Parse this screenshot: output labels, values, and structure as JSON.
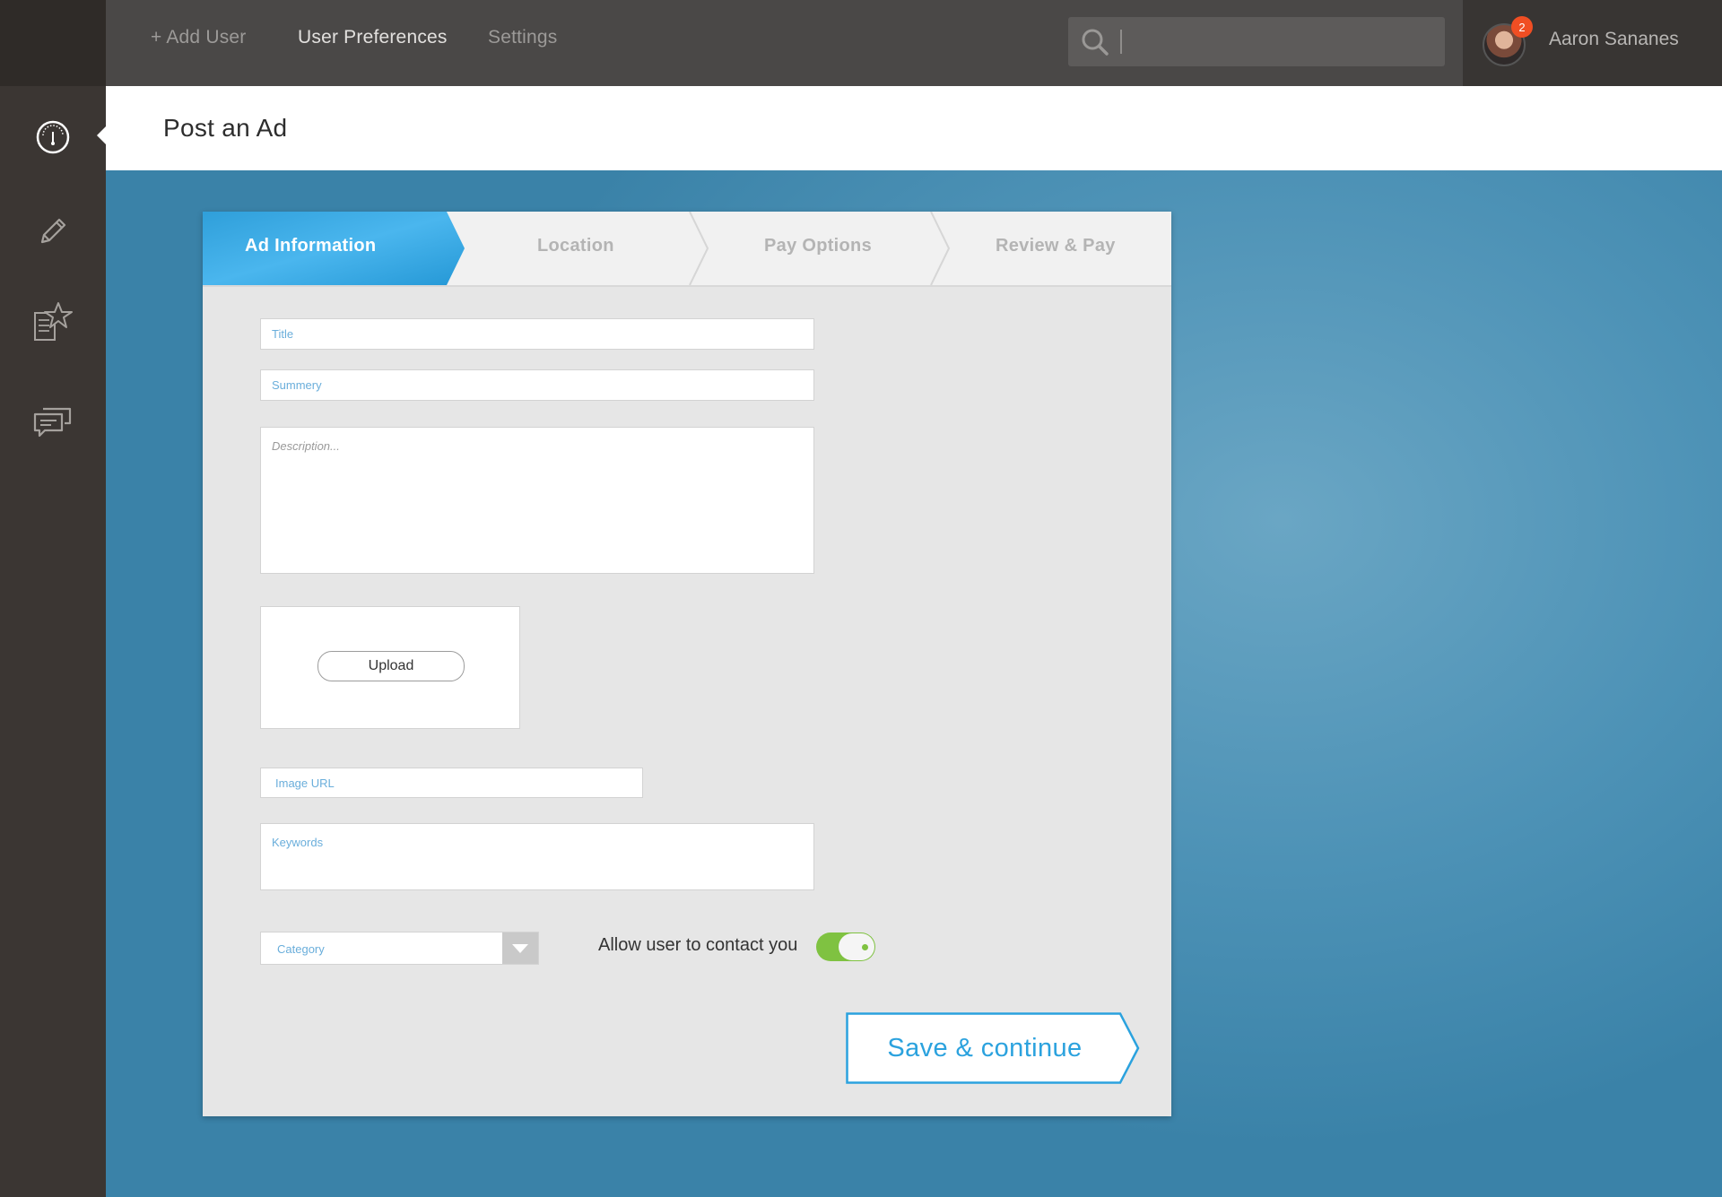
{
  "topbar": {
    "nav": [
      {
        "label": "+ Add User"
      },
      {
        "label": "User Preferences"
      },
      {
        "label": "Settings"
      }
    ],
    "search": {
      "placeholder": "",
      "value": ""
    },
    "user": {
      "name": "Aaron Sananes",
      "notification_count": "2"
    }
  },
  "sidebar": {
    "items": [
      {
        "icon": "gauge-icon",
        "active": true
      },
      {
        "icon": "pencil-icon",
        "active": false
      },
      {
        "icon": "favorites-document-icon",
        "active": false
      },
      {
        "icon": "chat-icon",
        "active": false
      }
    ]
  },
  "page": {
    "title": "Post an Ad"
  },
  "wizard": {
    "steps": [
      {
        "label": "Ad Information",
        "active": true
      },
      {
        "label": "Location",
        "active": false
      },
      {
        "label": "Pay Options",
        "active": false
      },
      {
        "label": "Review & Pay",
        "active": false
      }
    ]
  },
  "form": {
    "title_placeholder": "Title",
    "summary_placeholder": "Summery",
    "description_placeholder": "Description...",
    "upload_label": "Upload",
    "image_url_placeholder": "Image URL",
    "keywords_placeholder": "Keywords",
    "category_placeholder": "Category",
    "contact_label": "Allow user to contact you",
    "contact_allowed": true,
    "save_label": "Save & continue"
  },
  "colors": {
    "accent": "#2ba2de",
    "toggle_on": "#7fc241",
    "badge": "#f04e23",
    "main_bg": "#4d92b6"
  }
}
